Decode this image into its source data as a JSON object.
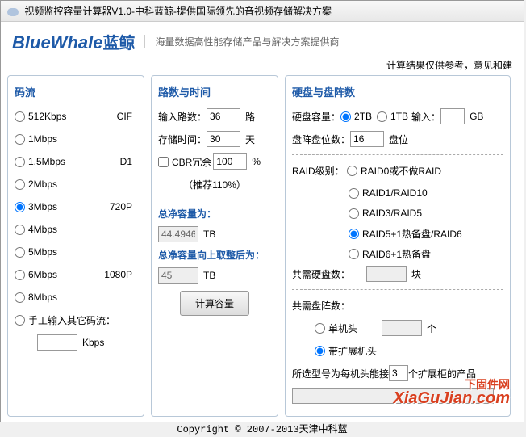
{
  "titlebar": "视频监控容量计算器V1.0-中科蓝鲸-提供国际领先的音视频存储解决方案",
  "logo_en": "BlueWhale",
  "logo_cn": "蓝鲸",
  "slogan": "海量数据高性能存储产品与解决方案提供商",
  "result_note": "计算结果仅供参考，意见和建",
  "bitrate": {
    "title": "码流",
    "options": [
      {
        "label": "512Kbps",
        "res": "CIF"
      },
      {
        "label": "1Mbps",
        "res": ""
      },
      {
        "label": "1.5Mbps",
        "res": "D1"
      },
      {
        "label": "2Mbps",
        "res": ""
      },
      {
        "label": "3Mbps",
        "res": "720P"
      },
      {
        "label": "4Mbps",
        "res": ""
      },
      {
        "label": "5Mbps",
        "res": ""
      },
      {
        "label": "6Mbps",
        "res": "1080P"
      },
      {
        "label": "8Mbps",
        "res": ""
      }
    ],
    "manual_label": "手工输入其它码流：",
    "manual_unit": "Kbps"
  },
  "paths": {
    "title": "路数与时间",
    "input_paths_label": "输入路数：",
    "input_paths_value": "36",
    "input_paths_unit": "路",
    "store_time_label": "存储时间：",
    "store_time_value": "30",
    "store_time_unit": "天",
    "cbr_label": "CBR冗余",
    "cbr_value": "100",
    "cbr_unit": "%",
    "cbr_hint": "（推荐110%）",
    "net_cap_label": "总净容量为：",
    "net_cap_value": "44.4946",
    "net_cap_unit": "TB",
    "ceil_label": "总净容量向上取整后为：",
    "ceil_value": "45",
    "ceil_unit": "TB",
    "calc_btn": "计算容量"
  },
  "disk": {
    "title": "硬盘与盘阵数",
    "disk_cap_label": "硬盘容量：",
    "opt_2tb": "2TB",
    "opt_1tb": "1TB",
    "opt_input": "输入：",
    "gb": "GB",
    "slots_label": "盘阵盘位数：",
    "slots_value": "16",
    "slots_unit": "盘位",
    "raid_label": "RAID级别：",
    "raid_opts": [
      "RAID0或不做RAID",
      "RAID1/RAID10",
      "RAID3/RAID5",
      "RAID5+1热备盘/RAID6",
      "RAID6+1热备盘"
    ],
    "need_disks_label": "共需硬盘数：",
    "need_disks_unit": "块",
    "need_arrays_label": "共需盘阵数：",
    "head_single": "单机头",
    "head_unit": "个",
    "head_expand": "带扩展机头",
    "model_label": "所选型号为每机头能接",
    "model_value": "3",
    "model_suffix": "个扩展柜的产品"
  },
  "footer": "Copyright © 2007-2013天津中科蓝",
  "watermark_cn": "下固件网",
  "watermark_en": "XiaGuJian.com"
}
